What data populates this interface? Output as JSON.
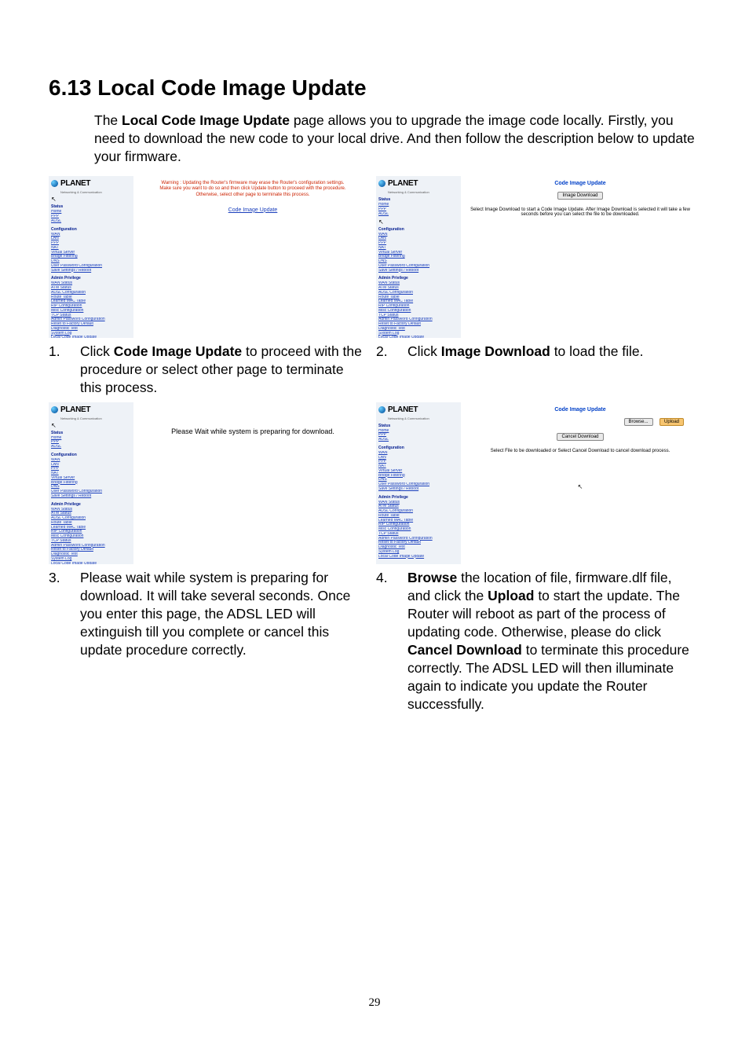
{
  "pageNumber": "29",
  "heading": "6.13 Local Code Image Update",
  "intro_before_bold": "The ",
  "intro_bold": "Local Code Image Update",
  "intro_after_bold": " page allows you to upgrade the image code locally. Firstly, you need to download the new code to your local drive. And then follow the description below to update your firmware.",
  "logo_text": "PLANET",
  "logo_sub": "Networking & Communication",
  "sidebar": {
    "head1": "Status",
    "status_links": [
      "Home",
      "PPP",
      "ADSL"
    ],
    "head2": "Configuration",
    "config_links": [
      "WAN",
      "LAN",
      "PPP",
      "NAT",
      "Virtual Server",
      "Bridge Filtering",
      "DNS",
      "User Password Configuration",
      "Save Settings / Reboot"
    ],
    "head3": "Admin Privilege",
    "admin_links": [
      "WAN Status",
      "ATM Status",
      "ADSL Configuration",
      "Route Table",
      "Learned MAC Table",
      "RIP Configuration",
      "Misc Configuration",
      "TCP Status",
      "Admin Password Configuration",
      "Reset to Factory Default",
      "Diagnostic Test",
      "System Log",
      "Local Code Image Update"
    ]
  },
  "shots": {
    "s1": {
      "warn_l1": "Warning : Updating the Router's firmware may erase the Router's configuration settings.",
      "warn_l2": "Make sure you want to do so and then click Update button to proceed with the procedure.",
      "warn_l3": "Otherwise, select other page to terminate this process.",
      "link": "Code Image Update"
    },
    "s2": {
      "title": "Code Image Update",
      "btn": "Image Download",
      "desc": "Select Image Download to start a Code Image Update. After Image Download is selected it will take a few seconds before you can select the file to be downloaded."
    },
    "s3": {
      "msg": "Please Wait while system is preparing for download."
    },
    "s4": {
      "title": "Code Image Update",
      "browse": "Browse...",
      "upload": "Upload",
      "cancel": "Cancel Download",
      "desc": "Select File to be downloaded or Select Cancel Download to cancel download process."
    }
  },
  "captions": {
    "c1_num": "1.",
    "c1_a": "Click ",
    "c1_b": "Code Image Update",
    "c1_c": " to proceed with the procedure or select other page to terminate this process.",
    "c2_num": "2.",
    "c2_a": "Click ",
    "c2_b": "Image Download",
    "c2_c": " to load the file.",
    "c3_num": "3.",
    "c3_a": "Please wait while system is preparing for download. It will take several seconds. Once you enter this page, the ADSL LED will extinguish till you complete or cancel this update procedure correctly.",
    "c4_num": "4.",
    "c4_b1": "Browse",
    "c4_a": " the location of file, firmware.dlf file, and click the ",
    "c4_b2": "Upload",
    "c4_c": " to start the update. The Router will reboot as part of the process of updating code. Otherwise, please do click ",
    "c4_b3": "Cancel Download",
    "c4_d": " to terminate this procedure correctly. The ADSL LED will then illuminate again to indicate you update the Router successfully."
  }
}
